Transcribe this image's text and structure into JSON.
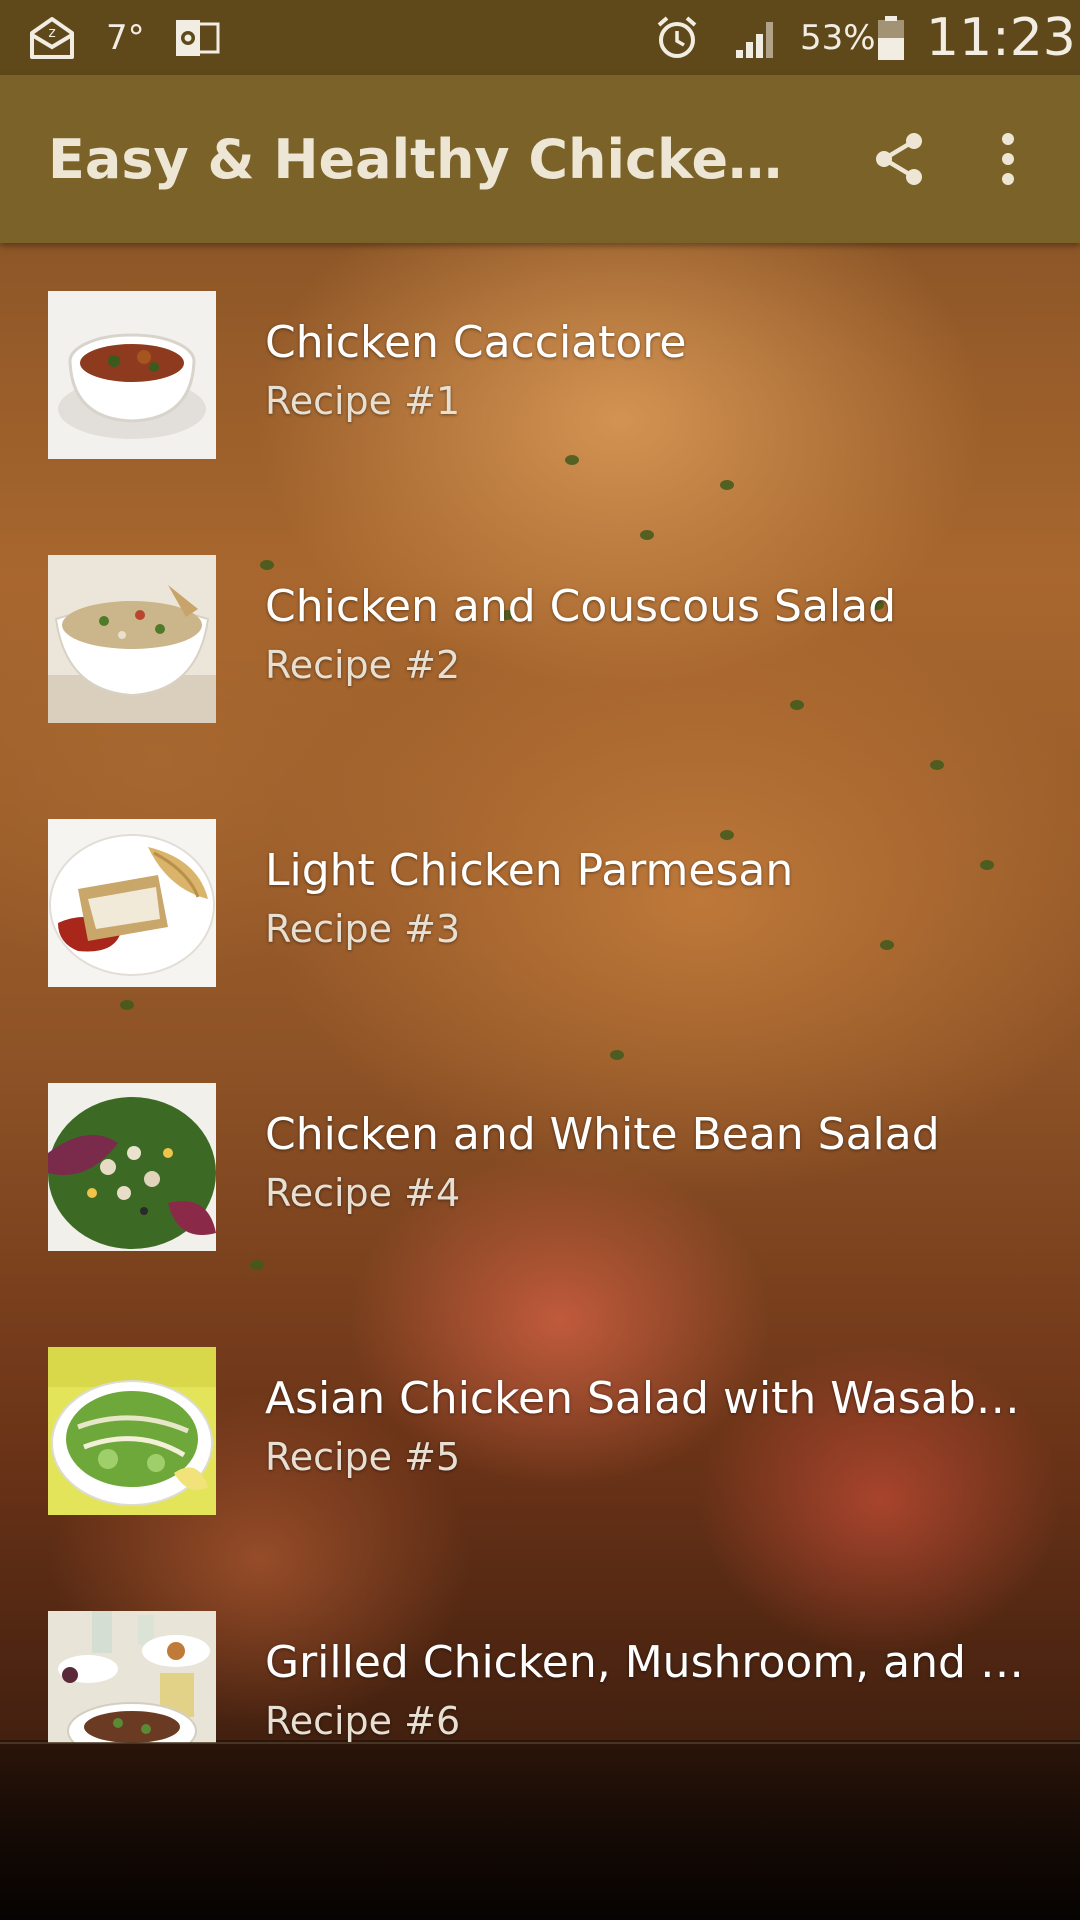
{
  "status_bar": {
    "temperature": "7°",
    "battery_percent": "53%",
    "time": "11:23",
    "icons": [
      "mail-notification-icon",
      "outlook-icon",
      "alarm-icon",
      "signal-icon",
      "battery-icon"
    ]
  },
  "app_bar": {
    "title": "Easy & Healthy Chicken Recipes",
    "actions": [
      "share-icon",
      "overflow-menu-icon"
    ]
  },
  "recipes": [
    {
      "title": "Chicken Cacciatore",
      "subtitle": "Recipe #1"
    },
    {
      "title": "Chicken and Couscous Salad",
      "subtitle": "Recipe #2"
    },
    {
      "title": "Light Chicken Parmesan",
      "subtitle": "Recipe #3"
    },
    {
      "title": "Chicken and White Bean Salad",
      "subtitle": "Recipe #4"
    },
    {
      "title": "Asian Chicken Salad with Wasabi Dressing",
      "subtitle": "Recipe #5"
    },
    {
      "title": "Grilled Chicken, Mushroom, and Fig Salad",
      "subtitle": "Recipe #6"
    }
  ],
  "colors": {
    "status_bar": "#5f491b",
    "app_bar": "#7b6228",
    "title_text": "#eee6d4",
    "list_text": "#ffffff"
  }
}
